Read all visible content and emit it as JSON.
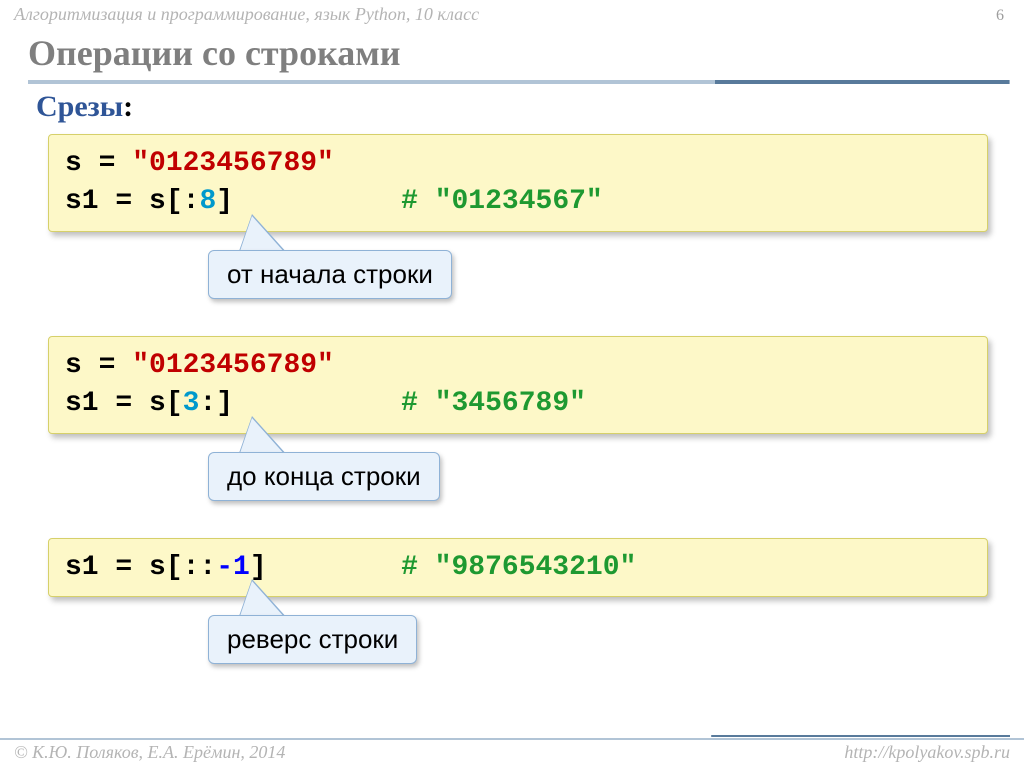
{
  "header": {
    "breadcrumb": "Алгоритмизация и программирование, язык Python, 10 класс",
    "page_number": "6"
  },
  "title": "Операции со строками",
  "subhead": "Срезы",
  "blocks": [
    {
      "line1_prefix": "s = ",
      "line1_str": "\"0123456789\"",
      "line2_prefix": "s1 = s[",
      "line2_slice_a": ":",
      "line2_slice_b": "8",
      "line2_suffix": "]",
      "line2_pad": "          ",
      "line2_comment": "# \"01234567\"",
      "callout": "от начала строки"
    },
    {
      "line1_prefix": "s = ",
      "line1_str": "\"0123456789\"",
      "line2_prefix": "s1 = s[",
      "line2_slice_a": "3",
      "line2_slice_b": ":",
      "line2_suffix": "]",
      "line2_pad": "          ",
      "line2_comment": "# \"3456789\"",
      "callout": "до конца строки"
    },
    {
      "line2_prefix": "s1 = s[",
      "line2_slice_a": "::",
      "line2_slice_b": "-1",
      "line2_suffix": "]",
      "line2_pad": "        ",
      "line2_comment": "# \"9876543210\"",
      "callout": "реверс строки"
    }
  ],
  "footer": {
    "left": "© К.Ю. Поляков, Е.А. Ерёмин, 2014",
    "right": "http://kpolyakov.spb.ru"
  }
}
